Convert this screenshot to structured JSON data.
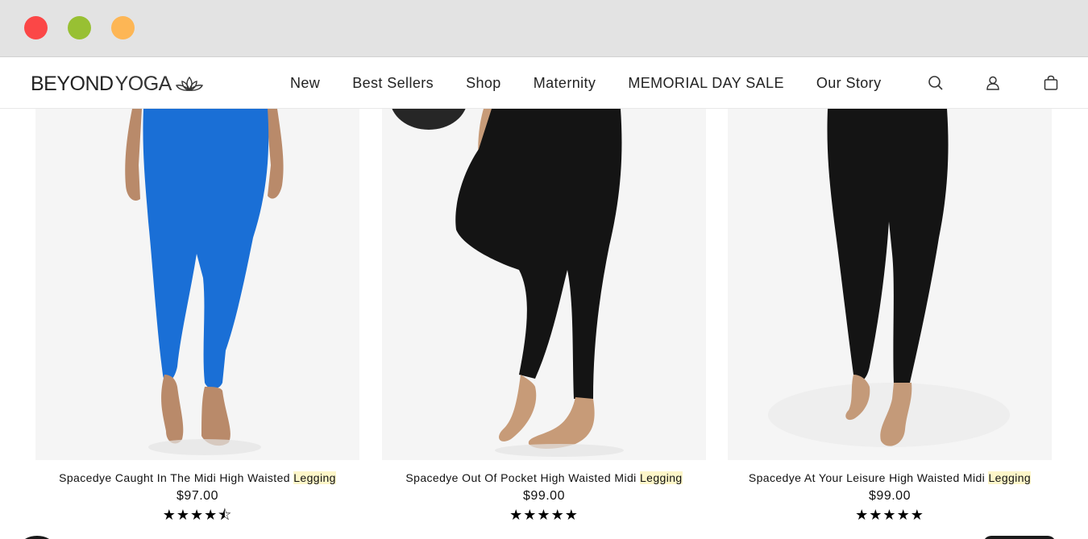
{
  "window": {
    "controls": [
      "close",
      "minimize",
      "maximize"
    ]
  },
  "header": {
    "logo_word1": "BEYOND",
    "logo_word2": "YOGA",
    "logo_icon": "lotus-icon",
    "nav": [
      "New",
      "Best Sellers",
      "Shop",
      "Maternity",
      "MEMORIAL DAY SALE",
      "Our Story"
    ],
    "icons": [
      "search-icon",
      "account-icon",
      "bag-icon"
    ]
  },
  "products": [
    {
      "name_prefix": "Spacedye Caught In The Midi High Waisted ",
      "name_highlight": "Legging",
      "price": "$97.00",
      "rating": 4.5,
      "stars": "★★★★⯪",
      "color": "#1a6fd6"
    },
    {
      "name_prefix": "Spacedye Out Of Pocket High Waisted Midi ",
      "name_highlight": "Legging",
      "price": "$99.00",
      "rating": 5,
      "stars": "★★★★★",
      "color": "#141414"
    },
    {
      "name_prefix": "Spacedye At Your Leisure High Waisted Midi ",
      "name_highlight": "Legging",
      "price": "$99.00",
      "rating": 5,
      "stars": "★★★★★",
      "color": "#141414"
    }
  ]
}
